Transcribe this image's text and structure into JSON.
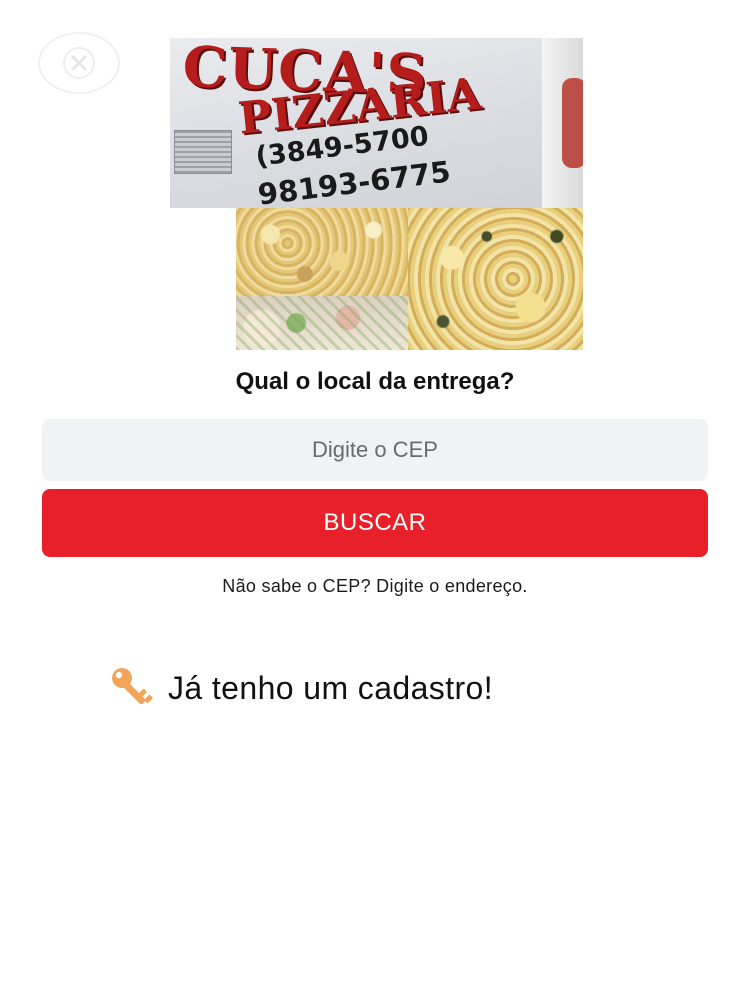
{
  "banner": {
    "brand_name": "CUCA'S",
    "brand_subtitle": "PIZZARIA",
    "phone_1": "(3849-5700",
    "phone_2": "98193-6775"
  },
  "delivery": {
    "question": "Qual o local da entrega?",
    "cep_placeholder": "Digite o CEP",
    "cep_value": "",
    "search_label": "BUSCAR",
    "address_link": "Não sabe o CEP? Digite o endereço."
  },
  "account": {
    "login_label": "Já tenho um cadastro!",
    "icon": "key-icon"
  },
  "colors": {
    "primary_button": "#e8202a",
    "input_background": "#f1f2f4",
    "key_icon": "#f2a45a"
  }
}
